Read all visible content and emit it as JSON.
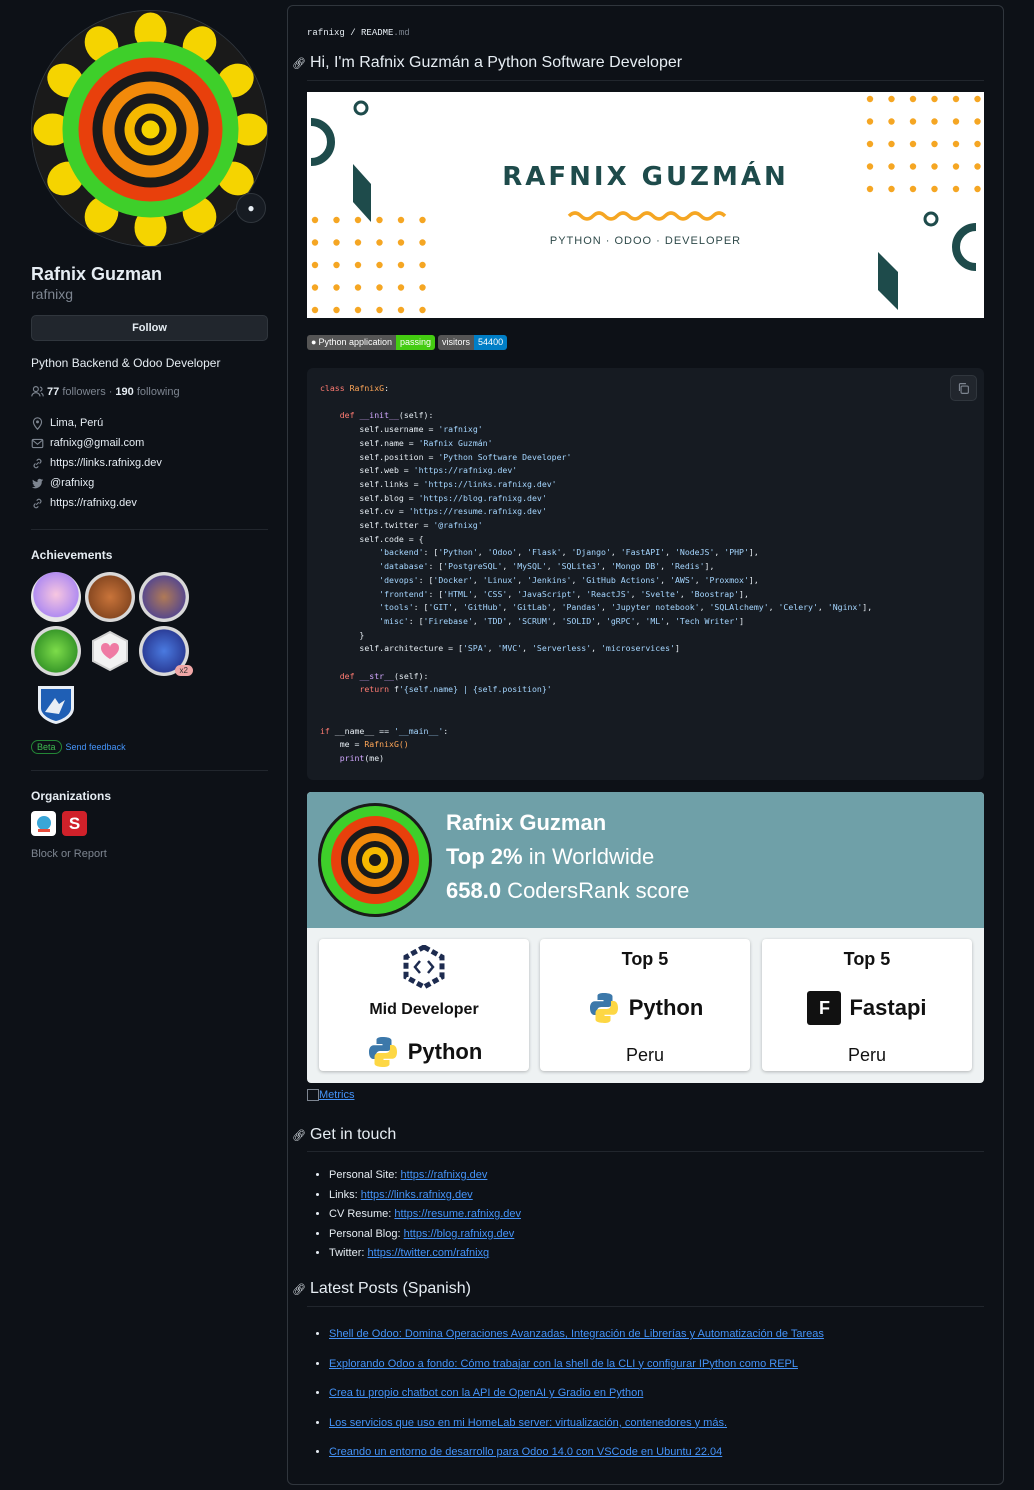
{
  "profile": {
    "fullname": "Rafnix Guzman",
    "login": "rafnixg",
    "follow_label": "Follow",
    "bio": "Python Backend & Odoo Developer",
    "followers_count": "77",
    "followers_label": "followers",
    "separator": "·",
    "following_count": "190",
    "following_label": "following",
    "location": "Lima, Perú",
    "email": "rafnixg@gmail.com",
    "link1": "https://links.rafnixg.dev",
    "twitter": "@rafnixg",
    "link2": "https://rafnixg.dev",
    "achievements_title": "Achievements",
    "badge_multiplier": "x2",
    "beta_label": "Beta",
    "feedback_label": "Send feedback",
    "organizations_title": "Organizations",
    "org_s_letter": "S",
    "block_label": "Block or Report"
  },
  "readme": {
    "crumb_user": "rafnixg",
    "crumb_sep": " / ",
    "crumb_file": "README",
    "crumb_ext": ".md",
    "heading": "Hi, I'm Rafnix Guzmán a Python Software Developer",
    "banner_name": "RAFNIX GUZMÁN",
    "banner_role": "PYTHON · ODOO · DEVELOPER",
    "shield_ci_label": "Python application",
    "shield_ci_value": "passing",
    "shield_visitors_label": "visitors",
    "shield_visitors_value": "54400",
    "metrics_alt": "Metrics",
    "get_in_touch_title": "Get in touch",
    "latest_posts_title": "Latest Posts (Spanish)"
  },
  "code_lines": [
    "class RafnixG:",
    "",
    "    def __init__(self):",
    "        self.username = 'rafnixg'",
    "        self.name = 'Rafnix Guzmán'",
    "        self.position = 'Python Software Developer'",
    "        self.web = 'https://rafnixg.dev'",
    "        self.links = 'https://links.rafnixg.dev'",
    "        self.blog = 'https://blog.rafnixg.dev'",
    "        self.cv = 'https://resume.rafnixg.dev'",
    "        self.twitter = '@rafnixg'",
    "        self.code = {",
    "            'backend': ['Python', 'Odoo', 'Flask', 'Django', 'FastAPI', 'NodeJS', 'PHP'],",
    "            'database': ['PostgreSQL', 'MySQL', 'SQLite3', 'Mongo DB', 'Redis'],",
    "            'devops': ['Docker', 'Linux', 'Jenkins', 'GitHub Actions', 'AWS', 'Proxmox'],",
    "            'frontend': ['HTML', 'CSS', 'JavaScript', 'ReactJS', 'Svelte', 'Boostrap'],",
    "            'tools': ['GIT', 'GitHub', 'GitLab', 'Pandas', 'Jupyter notebook', 'SQLAlchemy', 'Celery', 'Nginx'],",
    "            'misc': ['Firebase', 'TDD', 'SCRUM', 'SOLID', 'gRPC', 'ML', 'Tech Writer']",
    "        }",
    "        self.architecture = ['SPA', 'MVC', 'Serverless', 'microservices']",
    "",
    "    def __str__(self):",
    "        return f'{self.name} | {self.position}'",
    "",
    "",
    "if __name__ == '__main__':",
    "    me = RafnixG()",
    "    print(me)"
  ],
  "codersrank": {
    "name": "Rafnix Guzman",
    "rank_top": "Top 2%",
    "rank_rest": " in Worldwide",
    "score_value": "658.0",
    "score_rest": " CodersRank score",
    "card1_title": "Mid Developer",
    "card1_lang": "Python",
    "card2_title": "Top 5",
    "card2_lang": "Python",
    "card2_loc": "Peru",
    "card3_title": "Top 5",
    "card3_lang": "Fastapi",
    "card3_loc": "Peru",
    "fastapi_letter": "F"
  },
  "contacts": [
    {
      "label": "Personal Site: ",
      "url": "https://rafnixg.dev"
    },
    {
      "label": "Links: ",
      "url": "https://links.rafnixg.dev"
    },
    {
      "label": "CV Resume: ",
      "url": "https://resume.rafnixg.dev"
    },
    {
      "label": "Personal Blog: ",
      "url": "https://blog.rafnixg.dev"
    },
    {
      "label": "Twitter: ",
      "url": "https://twitter.com/rafnixg"
    }
  ],
  "posts": [
    "Shell de Odoo: Domina Operaciones Avanzadas, Integración de Librerías y Automatización de Tareas",
    "Explorando Odoo a fondo: Cómo trabajar con la shell de la CLI y configurar IPython como REPL",
    "Crea tu propio chatbot con la API de OpenAI y Gradio en Python",
    "Los servicios que uso en mi HomeLab server: virtualización, contenedores y más.",
    "Creando un entorno de desarrollo para Odoo 14.0 con VSCode en Ubuntu 22.04"
  ],
  "colors": {
    "background": "#0d1117",
    "link": "#4493f8",
    "muted": "#7d8590",
    "codersrank_header": "#6fa0a8",
    "banner_teal": "#1e4b4b",
    "banner_orange": "#f5a623"
  }
}
